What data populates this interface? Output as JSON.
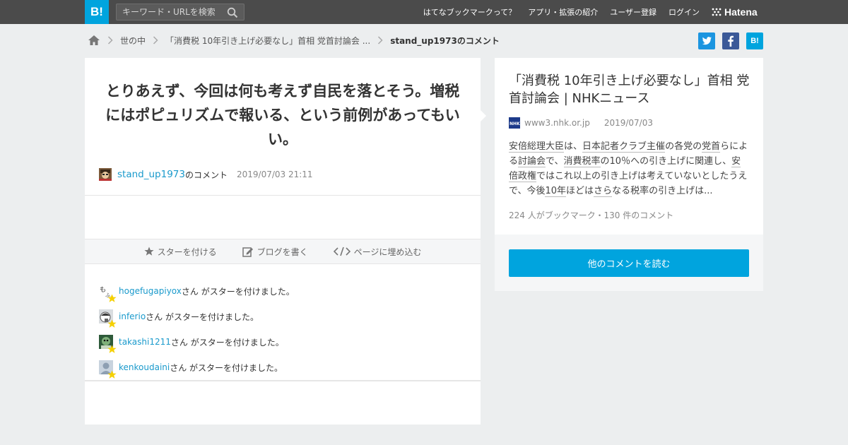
{
  "header": {
    "logo_text": "B!",
    "search_placeholder": "キーワード・URLを検索",
    "nav": [
      "はてなブックマークって？",
      "アプリ・拡張の紹介",
      "ユーザー登録",
      "ログイン"
    ],
    "brand": "Hatena",
    "bar_color": "#4b4b4b",
    "accent_color": "#00a4de"
  },
  "breadcrumb": {
    "items": [
      "世の中",
      "「消費税 10年引き上げ必要なし」首相 党首討論会 ..."
    ],
    "current": "stand_up1973のコメント"
  },
  "share": {
    "twitter_label": "t",
    "facebook_label": "f",
    "hatebu_label": "B!"
  },
  "comment": {
    "text": "とりあえず、今回は何も考えず自民を落とそう。増税にはポピュリズムで報いる、という前例があってもいい。",
    "author": "stand_up1973",
    "author_suffix": "のコメント",
    "timestamp": "2019/07/03 21:11"
  },
  "actions": {
    "star": "スターを付ける",
    "blog": "ブログを書く",
    "embed": "ページに埋め込む"
  },
  "stars": {
    "suffix": "さん がスターを付けました。",
    "users": [
      "hogefugapiyox",
      "inferio",
      "takashi1211",
      "kenkoudaini"
    ]
  },
  "entry": {
    "title": "「消費税 10年引き上げ必要なし」首相 党首討論会 | NHKニュース",
    "domain": "www3.nhk.or.jp",
    "date": "2019/07/03",
    "excerpt_segments": [
      {
        "t": "安倍総理大臣",
        "kw": true
      },
      {
        "t": "は、",
        "kw": false
      },
      {
        "t": "日本記者クラブ",
        "kw": true
      },
      {
        "t": "主催",
        "kw": true
      },
      {
        "t": "の各党の",
        "kw": false
      },
      {
        "t": "党首",
        "kw": true
      },
      {
        "t": "らによる",
        "kw": false
      },
      {
        "t": "討論会",
        "kw": true
      },
      {
        "t": "で、",
        "kw": false
      },
      {
        "t": "消費税率",
        "kw": true
      },
      {
        "t": "の10％への引き上げに関連し、",
        "kw": false
      },
      {
        "t": "安倍政権",
        "kw": true
      },
      {
        "t": "ではこれ以上の引き上げは考えていないとしたうえで、今後",
        "kw": false
      },
      {
        "t": "10年",
        "kw": true
      },
      {
        "t": "ほどは",
        "kw": false
      },
      {
        "t": "さら",
        "kw": true
      },
      {
        "t": "なる税率の引き上げは...",
        "kw": false
      }
    ],
    "stats": "224 人がブックマーク・130 件のコメント",
    "button_label": "他のコメントを読む"
  }
}
